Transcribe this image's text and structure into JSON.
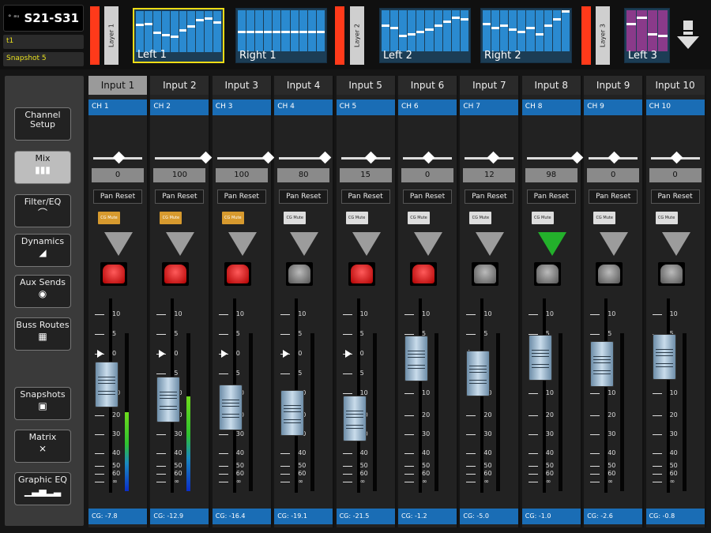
{
  "header": {
    "device_logo": "° ᵃᵘ",
    "device_name": "S21-S31",
    "show_name": "t1",
    "snapshot": "Snapshot 5"
  },
  "layers": [
    {
      "label": "Layer 1"
    },
    {
      "label": "Layer 2"
    },
    {
      "label": "Layer 3"
    }
  ],
  "mixes": [
    {
      "label": "Left 1",
      "selected": true,
      "levels": [
        0.3,
        0.28,
        0.5,
        0.55,
        0.6,
        0.45,
        0.35,
        0.2,
        0.15,
        0.25
      ],
      "color": "#2a8ad0"
    },
    {
      "label": "Right 1",
      "selected": false,
      "levels": [
        0.5,
        0.5,
        0.5,
        0.5,
        0.5,
        0.5,
        0.5,
        0.5,
        0.5,
        0.5
      ],
      "color": "#2a8ad0"
    },
    {
      "label": "Left 2",
      "selected": false,
      "levels": [
        0.35,
        0.4,
        0.6,
        0.55,
        0.5,
        0.45,
        0.35,
        0.25,
        0.15,
        0.2
      ],
      "color": "#2a8ad0"
    },
    {
      "label": "Right 2",
      "selected": false,
      "levels": [
        0.3,
        0.4,
        0.35,
        0.45,
        0.5,
        0.4,
        0.55,
        0.35,
        0.2,
        0.0
      ],
      "color": "#2a8ad0"
    },
    {
      "label": "Left 3",
      "selected": false,
      "levels": [
        0.3,
        0.15,
        0.55,
        0.6
      ],
      "color": "#8a3a8a"
    }
  ],
  "sidebar": [
    {
      "label": "Channel Setup",
      "icon": "",
      "active": false
    },
    {
      "label": "Mix",
      "icon": "mix-icon",
      "active": true
    },
    {
      "label": "Filter/EQ",
      "icon": "eq-curve-icon",
      "active": false
    },
    {
      "label": "Dynamics",
      "icon": "dynamics-icon",
      "active": false
    },
    {
      "label": "Aux Sends",
      "icon": "aux-icon",
      "active": false
    },
    {
      "label": "Buss Routes",
      "icon": "grid-icon",
      "active": false
    },
    {
      "label": "Snapshots",
      "icon": "camera-icon",
      "active": false
    },
    {
      "label": "Matrix",
      "icon": "matrix-icon",
      "active": false
    },
    {
      "label": "Graphic EQ",
      "icon": "geq-icon",
      "active": false
    }
  ],
  "pan_reset_label": "Pan Reset",
  "cg_mute_label": "CG Mute",
  "scale_labels": [
    "10",
    "5",
    "0",
    "5",
    "10",
    "20",
    "30",
    "40",
    "50",
    "60",
    "∞"
  ],
  "channels": [
    {
      "name": "Input 1",
      "ch": "CH 1",
      "pan": "0",
      "pan_pos": 0.5,
      "cg_mute": true,
      "tri": false,
      "mute": true,
      "fader_db": -7.8,
      "meter": 0.5,
      "cg": "CG: -7.8"
    },
    {
      "name": "Input 2",
      "ch": "CH 2",
      "pan": "100",
      "pan_pos": 1.0,
      "cg_mute": true,
      "tri": false,
      "mute": true,
      "fader_db": -12.9,
      "meter": 0.6,
      "cg": "CG: -12.9"
    },
    {
      "name": "Input 3",
      "ch": "CH 3",
      "pan": "100",
      "pan_pos": 1.0,
      "cg_mute": true,
      "tri": false,
      "mute": true,
      "fader_db": -16.4,
      "meter": 0.0,
      "cg": "CG: -16.4"
    },
    {
      "name": "Input 4",
      "ch": "CH 4",
      "pan": "80",
      "pan_pos": 0.9,
      "cg_mute": false,
      "tri": false,
      "mute": false,
      "fader_db": -19.1,
      "meter": 0.0,
      "cg": "CG: -19.1"
    },
    {
      "name": "Input 5",
      "ch": "CH 5",
      "pan": "15",
      "pan_pos": 0.58,
      "cg_mute": false,
      "tri": false,
      "mute": true,
      "fader_db": -21.5,
      "meter": 0.0,
      "cg": "CG: -21.5"
    },
    {
      "name": "Input 6",
      "ch": "CH 6",
      "pan": "0",
      "pan_pos": 0.5,
      "cg_mute": false,
      "tri": false,
      "mute": true,
      "fader_db": -1.2,
      "meter": 0.0,
      "cg": "CG: -1.2"
    },
    {
      "name": "Input 7",
      "ch": "CH 7",
      "pan": "12",
      "pan_pos": 0.56,
      "cg_mute": false,
      "tri": false,
      "mute": false,
      "fader_db": -5.0,
      "meter": 0.0,
      "cg": "CG: -5.0"
    },
    {
      "name": "Input 8",
      "ch": "CH 8",
      "pan": "98",
      "pan_pos": 0.99,
      "cg_mute": false,
      "tri": true,
      "mute": false,
      "fader_db": -1.0,
      "meter": 0.0,
      "cg": "CG: -1.0"
    },
    {
      "name": "Input 9",
      "ch": "CH 9",
      "pan": "0",
      "pan_pos": 0.5,
      "cg_mute": false,
      "tri": false,
      "mute": false,
      "fader_db": -2.6,
      "meter": 0.0,
      "cg": "CG: -2.6"
    },
    {
      "name": "Input 10",
      "ch": "CH 10",
      "pan": "0",
      "pan_pos": 0.5,
      "cg_mute": false,
      "tri": false,
      "mute": false,
      "fader_db": -0.8,
      "meter": 0.0,
      "cg": "CG: -0.8"
    }
  ]
}
